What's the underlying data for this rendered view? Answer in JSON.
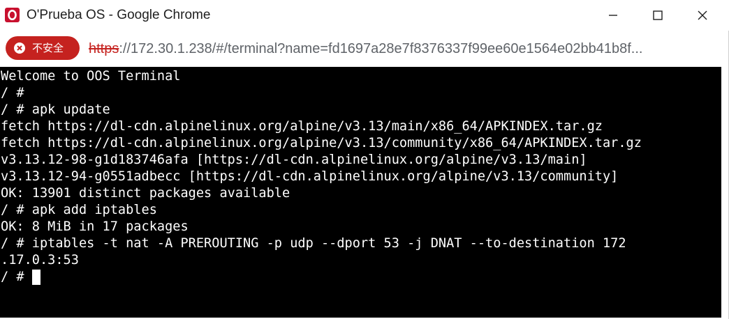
{
  "window": {
    "title": "O'Prueba OS - Google Chrome"
  },
  "address_bar": {
    "security_label": "不安全",
    "url_scheme": "https",
    "url_rest": "://172.30.1.238/#/terminal?name=fd1697a28e7f8376337f99ee60e1564e02bb41b8f..."
  },
  "terminal": {
    "lines": [
      "Welcome to OOS Terminal",
      "/ #",
      "/ # apk update",
      "fetch https://dl-cdn.alpinelinux.org/alpine/v3.13/main/x86_64/APKINDEX.tar.gz",
      "fetch https://dl-cdn.alpinelinux.org/alpine/v3.13/community/x86_64/APKINDEX.tar.gz",
      "v3.13.12-98-g1d183746afa [https://dl-cdn.alpinelinux.org/alpine/v3.13/main]",
      "v3.13.12-94-g0551adbecc [https://dl-cdn.alpinelinux.org/alpine/v3.13/community]",
      "OK: 13901 distinct packages available",
      "/ # apk add iptables",
      "OK: 8 MiB in 17 packages",
      "/ # iptables -t nat -A PREROUTING -p udp --dport 53 -j DNAT --to-destination 172",
      ".17.0.3:53"
    ],
    "prompt": "/ # "
  },
  "colors": {
    "accent_red": "#c5221f",
    "terminal_bg": "#000000",
    "terminal_fg": "#ffffff"
  }
}
